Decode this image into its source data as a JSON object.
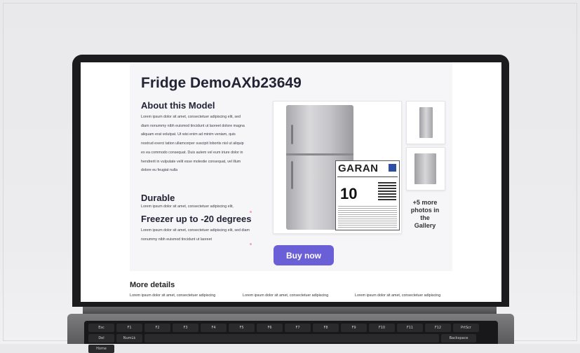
{
  "page": {
    "title": "Fridge DemoAXb23649",
    "about_heading": "About this Model",
    "about_text": "Lorem ipsum dolor sit amet, consectetuer adipiscing elit, sed diam nonummy nibh euismod tincidunt ut laoreet dolore magna aliquam erat volutpat. Ut wisi enim ad minim veniam, quis nostrud exerci tation ullamcorper suscipit lobortis nisl ut aliquip ex ea commodo consequat. Duis autem vel eum iriure dolor in hendrerit in vulputate velit esse molestie consequat, vel illum dolore eu feugiat nulla",
    "durable_heading": "Durable",
    "durable_text": "Lorem ipsum dolor sit amet, consectetuer adipiscing elit,",
    "freezer_heading": "Freezer up to -20 degrees",
    "freezer_text": "Lorem ipsum dolor sit amet, consectetuer adipiscing elit, sed diam nonummy nibh euismod tincidunt ut laoreet",
    "more_photos": "+5 more photos in the Gallery",
    "buy_label": "Buy now",
    "more_details_heading": "More details",
    "details": [
      "Lorem ipsum dolor sit amet, consectetuer adipiscing",
      "Lorem ipsum dolor sit amet, consectetuer adipiscing",
      "Lorem ipsum dolor sit amet, consectetuer adipiscing"
    ]
  },
  "label": {
    "brand": "GARAN",
    "number": "10"
  },
  "keyboard": {
    "keys": [
      "Esc",
      "F1",
      "F2",
      "F3",
      "F4",
      "F5",
      "F6",
      "F7",
      "F8",
      "F9",
      "F10",
      "F11",
      "F12",
      "PrtScr",
      "Del",
      "NumLk"
    ],
    "bottom_keys": [
      "Backspace",
      "Home"
    ]
  },
  "colors": {
    "accent": "#6a5fd6",
    "panel": "#f6f6f8",
    "bezel": "#1c1c1e"
  }
}
